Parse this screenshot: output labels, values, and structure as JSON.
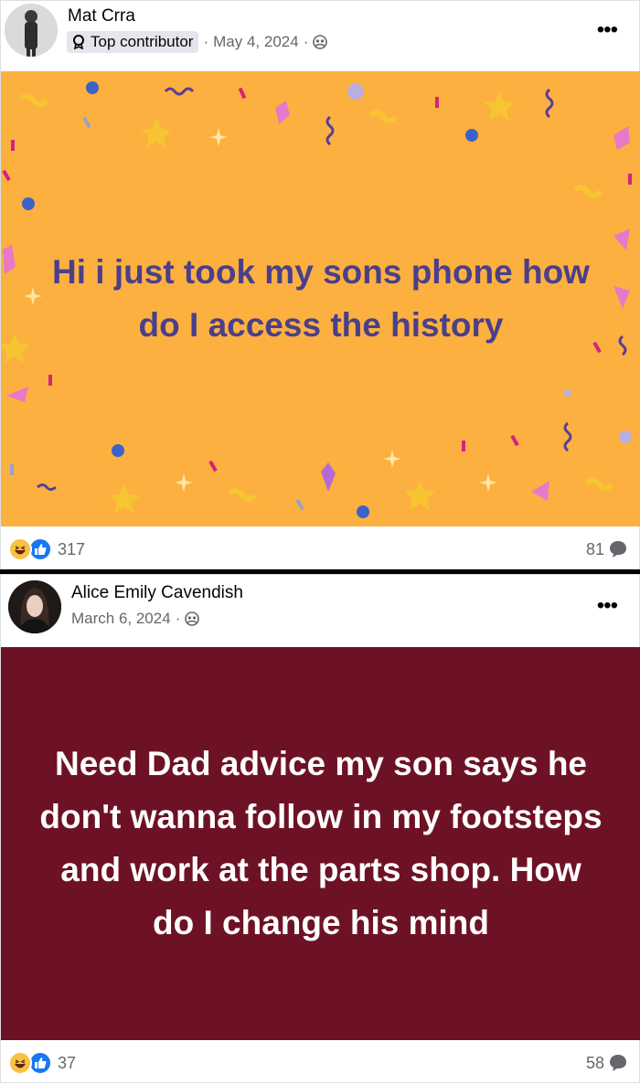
{
  "posts": [
    {
      "author": "Mat Crra",
      "badge": "Top contributor",
      "date": "May 4, 2024",
      "audience_icon": "friends-icon",
      "text": "Hi i just took my sons phone how do I access the history",
      "background": "#fcb040",
      "text_color": "#4b3f8a",
      "reaction_count": "317",
      "comment_count": "81"
    },
    {
      "author": "Alice Emily Cavendish",
      "date": "March 6, 2024",
      "audience_icon": "friends-icon",
      "text": "Need Dad advice my son says he don't wanna follow in my footsteps and work at the parts shop. How do I change his mind",
      "background": "#6d1224",
      "text_color": "#ffffff",
      "reaction_count": "37",
      "comment_count": "58"
    }
  ],
  "more_label": "•••",
  "separator": " · ",
  "colors": {
    "like": "#1877f2",
    "haha": "#f7c144",
    "meta": "#65676b"
  }
}
